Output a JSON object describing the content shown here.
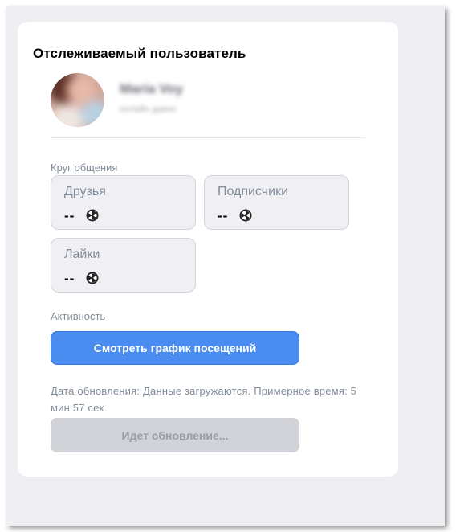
{
  "header": {
    "title": "Отслеживаемый пользователь"
  },
  "user": {
    "name": "Maria Voy",
    "subtitle": "онлайн давно"
  },
  "circle": {
    "section_label": "Круг общения",
    "friends": {
      "label": "Друзья",
      "value": "--"
    },
    "followers": {
      "label": "Подписчики",
      "value": "--"
    },
    "likes": {
      "label": "Лайки",
      "value": "--"
    }
  },
  "activity": {
    "section_label": "Активность",
    "view_chart_button": "Смотреть график посещений"
  },
  "update": {
    "info_text": "Дата обновления: Данные загружаются. Примерное время: 5 мин 57 сек",
    "status_button": "Идет обновление..."
  },
  "colors": {
    "accent": "#4a8cf0",
    "background": "#eeeef3",
    "muted_text": "#818c99"
  }
}
